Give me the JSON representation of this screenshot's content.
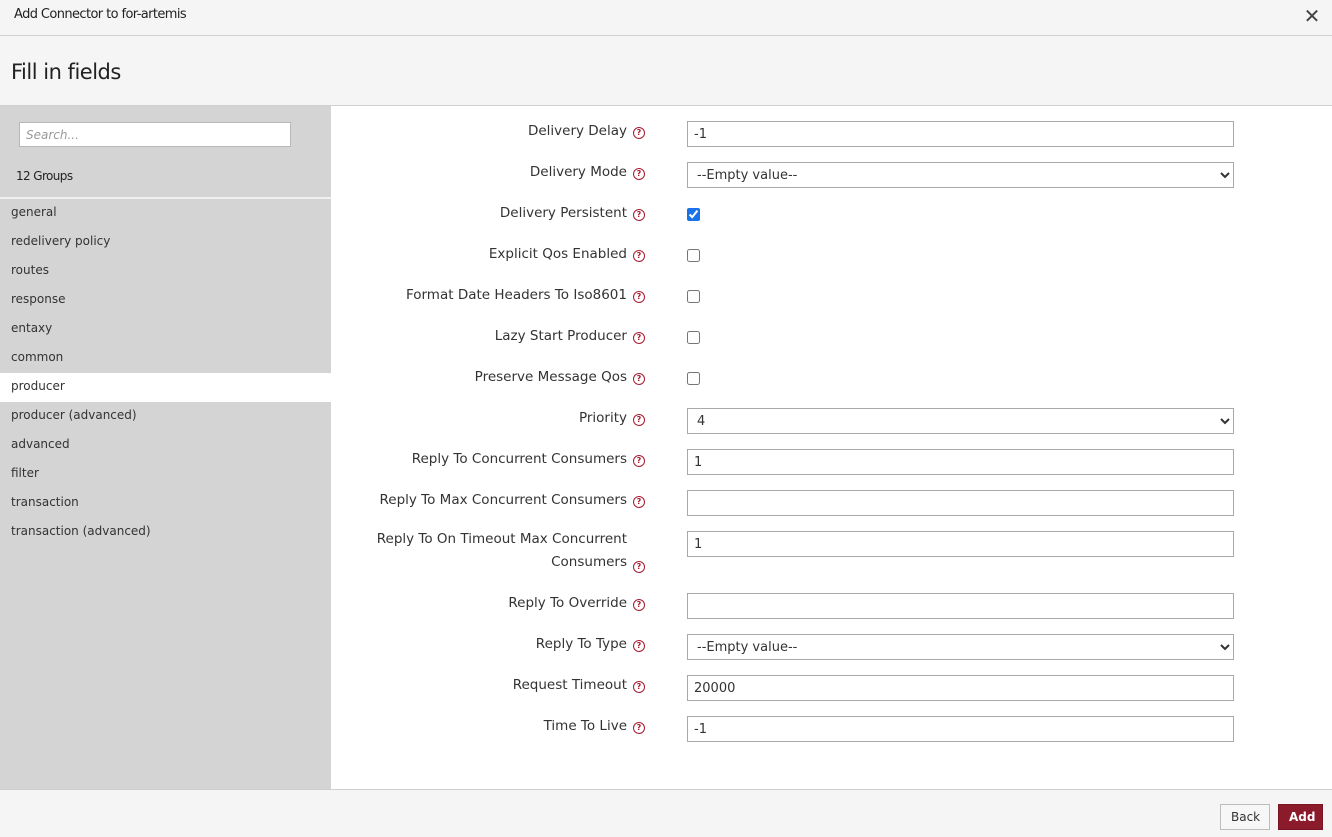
{
  "window": {
    "title": "Add Connector to for-artemis",
    "close_icon": "close-icon"
  },
  "header": {
    "heading": "Fill in fields"
  },
  "sidebar": {
    "search_placeholder": "Search...",
    "groups_count": "12 Groups",
    "groups": [
      {
        "label": "general",
        "active": false
      },
      {
        "label": "redelivery policy",
        "active": false
      },
      {
        "label": "routes",
        "active": false
      },
      {
        "label": "response",
        "active": false
      },
      {
        "label": "entaxy",
        "active": false
      },
      {
        "label": "common",
        "active": false
      },
      {
        "label": "producer",
        "active": true
      },
      {
        "label": "producer (advanced)",
        "active": false
      },
      {
        "label": "advanced",
        "active": false
      },
      {
        "label": "filter",
        "active": false
      },
      {
        "label": "transaction",
        "active": false
      },
      {
        "label": "transaction (advanced)",
        "active": false
      }
    ]
  },
  "form": {
    "fields": [
      {
        "label": "Delivery Delay",
        "type": "text",
        "value": "-1"
      },
      {
        "label": "Delivery Mode",
        "type": "select",
        "value": "--Empty value--"
      },
      {
        "label": "Delivery Persistent",
        "type": "checkbox",
        "checked": true
      },
      {
        "label": "Explicit Qos Enabled",
        "type": "checkbox",
        "checked": false
      },
      {
        "label": "Format Date Headers To Iso8601",
        "type": "checkbox",
        "checked": false
      },
      {
        "label": "Lazy Start Producer",
        "type": "checkbox",
        "checked": false
      },
      {
        "label": "Preserve Message Qos",
        "type": "checkbox",
        "checked": false
      },
      {
        "label": "Priority",
        "type": "select",
        "value": "4"
      },
      {
        "label": "Reply To Concurrent Consumers",
        "type": "text",
        "value": "1"
      },
      {
        "label": "Reply To Max Concurrent Consumers",
        "type": "text",
        "value": ""
      },
      {
        "label": "Reply To On Timeout Max Concurrent Consumers",
        "type": "text",
        "value": "1"
      },
      {
        "label": "Reply To Override",
        "type": "text",
        "value": ""
      },
      {
        "label": "Reply To Type",
        "type": "select",
        "value": "--Empty value--"
      },
      {
        "label": "Request Timeout",
        "type": "text",
        "value": "20000"
      },
      {
        "label": "Time To Live",
        "type": "text",
        "value": "-1"
      }
    ],
    "help_icon": "help-circle-icon"
  },
  "footer": {
    "back_label": "Back",
    "add_label": "Add"
  },
  "colors": {
    "accent": "#8b1a2b",
    "help": "#a8192e",
    "sidebar_bg": "#d4d4d4"
  }
}
